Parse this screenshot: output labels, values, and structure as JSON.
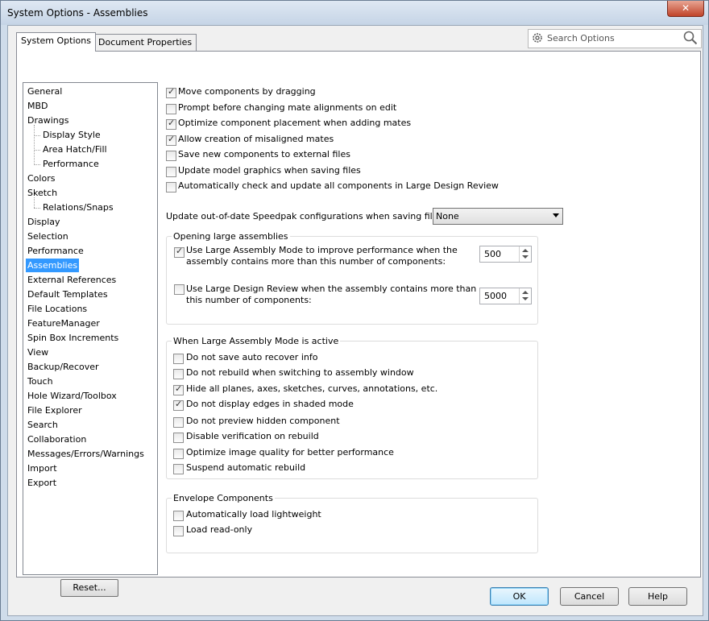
{
  "window": {
    "title": "System Options - Assemblies",
    "close": "✕"
  },
  "tabs": [
    "System Options",
    "Document Properties"
  ],
  "search": {
    "placeholder": "Search Options"
  },
  "tree": {
    "items": [
      "General",
      "MBD",
      "Drawings",
      "Display Style",
      "Area Hatch/Fill",
      "Performance",
      "Colors",
      "Sketch",
      "Relations/Snaps",
      "Display",
      "Selection",
      "Performance",
      "Assemblies",
      "External References",
      "Default Templates",
      "File Locations",
      "FeatureManager",
      "Spin Box Increments",
      "View",
      "Backup/Recover",
      "Touch",
      "Hole Wizard/Toolbox",
      "File Explorer",
      "Search",
      "Collaboration",
      "Messages/Errors/Warnings",
      "Import",
      "Export"
    ],
    "selected": "Assemblies"
  },
  "reset_label": "Reset...",
  "options": [
    {
      "label": "Move components by dragging",
      "checked": true
    },
    {
      "label": "Prompt before changing mate alignments on edit",
      "checked": false
    },
    {
      "label": "Optimize component placement when adding mates",
      "checked": true
    },
    {
      "label": "Allow creation of misaligned mates",
      "checked": true
    },
    {
      "label": "Save new components to external files",
      "checked": false
    },
    {
      "label": "Update model graphics when saving files",
      "checked": false
    },
    {
      "label": "Automatically check and update all components in Large Design Review",
      "checked": false
    }
  ],
  "speedpak": {
    "label": "Update out-of-date Speedpak configurations when saving files:",
    "value": "None"
  },
  "opening": {
    "title": "Opening large assemblies",
    "lam": {
      "line1": "Use Large Assembly Mode to improve performance when the",
      "line2": "assembly contains more than this number of components:",
      "checked": true,
      "value": "500"
    },
    "ldr": {
      "line1": "Use Large Design Review when the assembly contains more than",
      "line2": "this number of components:",
      "checked": false,
      "value": "5000"
    }
  },
  "lam_active": {
    "title": "When Large Assembly Mode is active",
    "items": [
      {
        "label": "Do not save auto recover info",
        "checked": false
      },
      {
        "label": "Do not rebuild when switching to assembly window",
        "checked": false
      },
      {
        "label": "Hide all planes, axes, sketches, curves, annotations, etc.",
        "checked": true
      },
      {
        "label": "Do not display edges in shaded mode",
        "checked": true
      },
      {
        "label": "Do not preview hidden component",
        "checked": false
      },
      {
        "label": "Disable verification on rebuild",
        "checked": false
      },
      {
        "label": "Optimize image quality for better performance",
        "checked": false
      },
      {
        "label": "Suspend automatic rebuild",
        "checked": false
      }
    ]
  },
  "envelope": {
    "title": "Envelope Components",
    "items": [
      {
        "label": "Automatically load lightweight",
        "checked": false
      },
      {
        "label": "Load read-only",
        "checked": false
      }
    ]
  },
  "buttons": {
    "ok": "OK",
    "cancel": "Cancel",
    "help": "Help"
  }
}
